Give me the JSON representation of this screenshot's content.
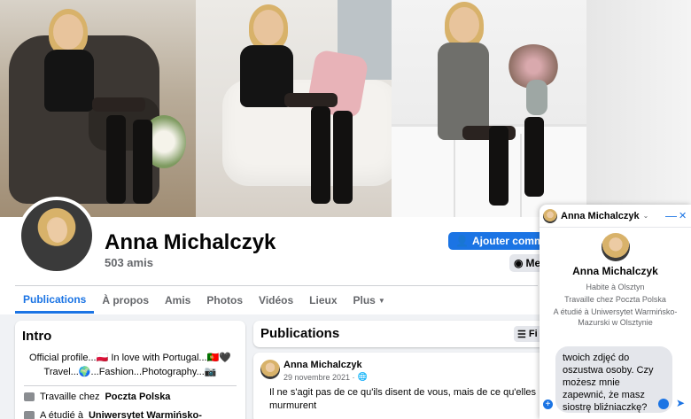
{
  "profile": {
    "name": "Anna Michalczyk",
    "friends": "503 amis"
  },
  "actions": {
    "add_friend": "Ajouter comme ami",
    "message": "Message"
  },
  "tabs": [
    {
      "label": "Publications",
      "active": true
    },
    {
      "label": "À propos",
      "active": false
    },
    {
      "label": "Amis",
      "active": false
    },
    {
      "label": "Photos",
      "active": false
    },
    {
      "label": "Vidéos",
      "active": false
    },
    {
      "label": "Lieux",
      "active": false
    },
    {
      "label": "Plus",
      "active": false
    }
  ],
  "intro": {
    "title": "Intro",
    "bio_line1": "Official profile...🇵🇱 In love with Portugal...🇵🇹🖤",
    "bio_line2": "Travel...🌍...Fashion...Photography...📷",
    "work_prefix": "Travaille chez",
    "work_place": "Poczta Polska",
    "study_prefix": "A étudié à",
    "study_place": "Uniwersytet Warmińsko-"
  },
  "publications": {
    "title": "Publications",
    "filter_label": "Fi"
  },
  "post": {
    "author": "Anna Michalczyk",
    "date": "29 novembre 2021 ·",
    "text": "Il ne s'agit pas de ce qu'ils disent de vous, mais de ce qu'elles murmurent"
  },
  "chat": {
    "header_name": "Anna Michalczyk",
    "title": "Anna Michalczyk",
    "lives": "Habite à Olsztyn",
    "works": "Travaille chez Poczta Polska",
    "studied": "A étudié à Uniwersytet Warmińsko-Mazurski w Olsztynie",
    "message": "twoich zdjęć do oszustwa osoby. Czy możesz mnie zapewnić, że masz siostrę bliźniaczkę?",
    "minimize": "—",
    "close": "✕"
  },
  "colors": {
    "accent": "#1b74e4",
    "background": "#f0f2f5"
  }
}
